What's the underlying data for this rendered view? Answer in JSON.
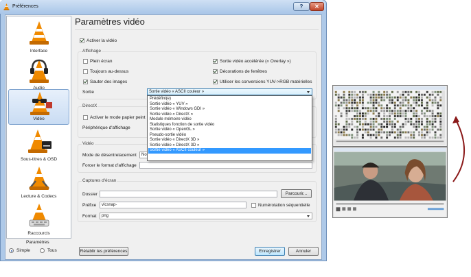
{
  "window": {
    "title": "Préférences",
    "help_symbol": "?",
    "close_symbol": "✕"
  },
  "sidebar": {
    "items": [
      {
        "label": "Interface",
        "icon": "interface-cone-icon",
        "selected": false
      },
      {
        "label": "Audio",
        "icon": "headphones-cone-icon",
        "selected": false
      },
      {
        "label": "Vidéo",
        "icon": "glasses-cone-icon",
        "selected": true
      },
      {
        "label": "Sous-titres & OSD",
        "icon": "subtitles-cone-icon",
        "selected": false
      },
      {
        "label": "Lecture & Codecs",
        "icon": "codecs-cone-icon",
        "selected": false
      },
      {
        "label": "Raccourcis",
        "icon": "hotkeys-cone-icon",
        "selected": false
      }
    ],
    "mode_title": "Paramètres",
    "mode_simple": "Simple",
    "mode_all": "Tous",
    "mode_selected": "Simple"
  },
  "page": {
    "title": "Paramètres vidéo",
    "enable_video": "Activer la vidéo",
    "display": {
      "title": "Affichage",
      "fullscreen": "Plein écran",
      "always_on_top": "Toujours au-dessus",
      "skip_frames": "Sauter des images",
      "accelerated": "Sortie vidéo accélérée (« Overlay »)",
      "decorations": "Décorations de fenêtres",
      "hw_yuv_rgb": "Utiliser les conversions YUV->RGB matérielles",
      "output_label": "Sortie",
      "output_value": "Sortie vidéo « ASCII couleur »"
    },
    "directx": {
      "title": "DirectX",
      "wallpaper": "Activer le mode papier peint",
      "device_label": "Périphérique d'affichage"
    },
    "video": {
      "title": "Vidéo",
      "deinterlace_label": "Mode de désentrelacement",
      "deinterlace_value": "No",
      "aspect_label": "Forcer le format d'affichage"
    },
    "snapshots": {
      "title": "Captures d'écran",
      "folder_label": "Dossier",
      "folder_value": "",
      "browse": "Parcourir...",
      "prefix_label": "Préfixe",
      "prefix_value": "vlcsnap-",
      "sequential": "Numérotation séquentielle",
      "format_label": "Format",
      "format_value": "png"
    },
    "dropdown_options": [
      "Prédéfini(e)",
      "Sortie vidéo « YUV »",
      "Sortie vidéo « Windows GDI »",
      "Sortie vidéo « DirectX »",
      "Module mémoire vidéo",
      "Statistiques fonction de sortie vidéo",
      "Sortie vidéo « OpenGL »",
      "Pseudo-sortie vidéo",
      "Sortie vidéo « DirectX 3D »",
      "Sortie vidéo « DirectX 3D »",
      "Sortie vidéo « ASCII couleur »"
    ],
    "dropdown_selected_index": 10
  },
  "footer": {
    "reset": "Rétablir les préférences",
    "save": "Enregistrer",
    "cancel": "Annuler"
  },
  "colors": {
    "selection": "#3399ff",
    "accent_arrow": "#8b1a1a",
    "cone_orange": "#f08a00"
  }
}
